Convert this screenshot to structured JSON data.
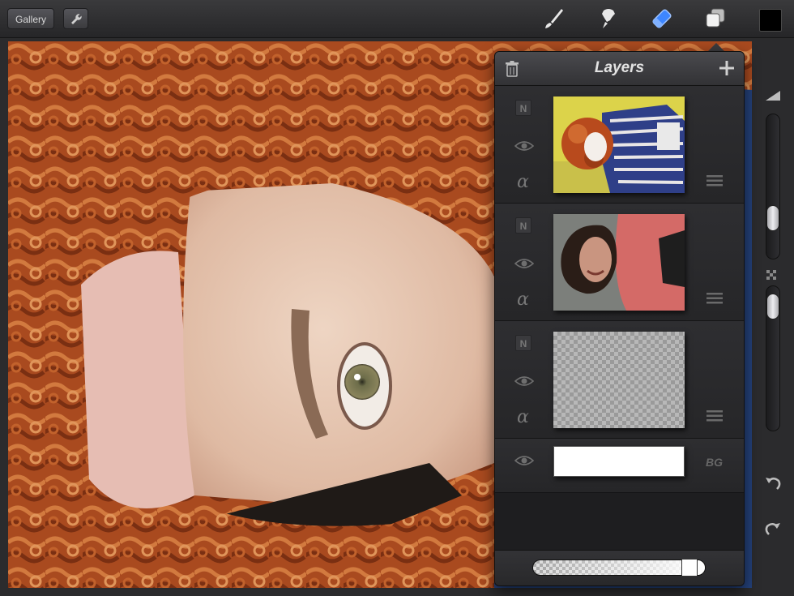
{
  "toolbar": {
    "gallery_label": "Gallery",
    "tools": [
      "brush-icon",
      "smudge-icon",
      "eraser-icon",
      "layers-icon"
    ],
    "active_tool": "eraser-icon",
    "active_color": "#000000"
  },
  "layers_panel": {
    "title": "Layers",
    "layers": [
      {
        "blend": "N",
        "thumbnail": "woman-red-hair-striped-shirt"
      },
      {
        "blend": "N",
        "thumbnail": "woman-dark-hair-pink-jacket"
      },
      {
        "blend": "N",
        "thumbnail": "empty-transparent-layer"
      }
    ],
    "background": {
      "label": "BG",
      "color": "#ffffff"
    },
    "opacity": 0.95
  },
  "colors": {
    "accent": "#3d86ff",
    "panel": "#1e1e20",
    "toolbar": "#2f2f31"
  }
}
